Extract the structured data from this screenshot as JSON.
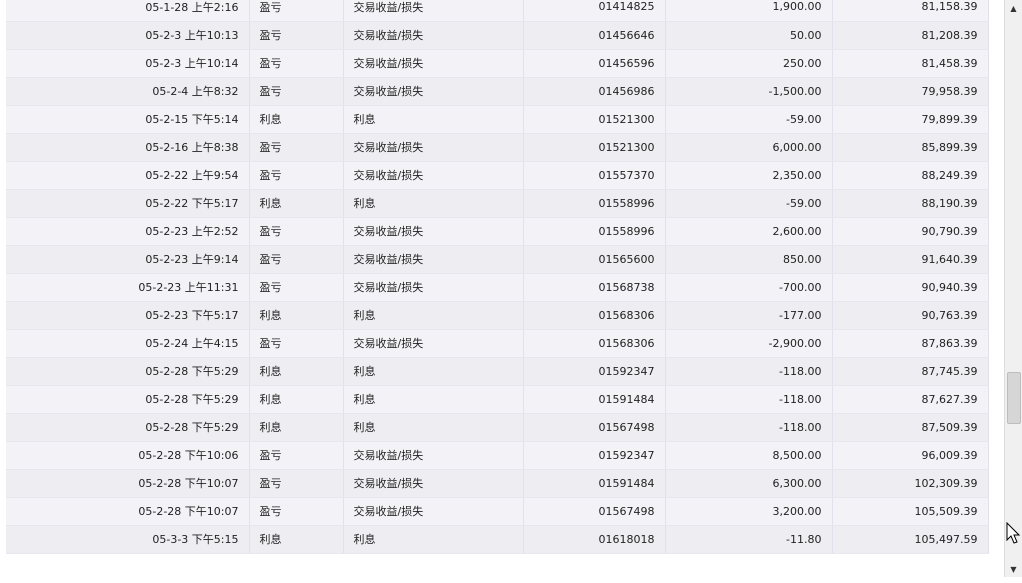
{
  "ledger": {
    "rows": [
      {
        "date": "05-1-28 上午2:16",
        "type": "盈亏",
        "desc": "交易收益/损失",
        "ticket": "01414825",
        "amount": "1,900.00",
        "balance": "81,158.39"
      },
      {
        "date": "05-2-3 上午10:13",
        "type": "盈亏",
        "desc": "交易收益/损失",
        "ticket": "01456646",
        "amount": "50.00",
        "balance": "81,208.39"
      },
      {
        "date": "05-2-3 上午10:14",
        "type": "盈亏",
        "desc": "交易收益/损失",
        "ticket": "01456596",
        "amount": "250.00",
        "balance": "81,458.39"
      },
      {
        "date": "05-2-4 上午8:32",
        "type": "盈亏",
        "desc": "交易收益/损失",
        "ticket": "01456986",
        "amount": "-1,500.00",
        "balance": "79,958.39"
      },
      {
        "date": "05-2-15 下午5:14",
        "type": "利息",
        "desc": "利息",
        "ticket": "01521300",
        "amount": "-59.00",
        "balance": "79,899.39"
      },
      {
        "date": "05-2-16 上午8:38",
        "type": "盈亏",
        "desc": "交易收益/损失",
        "ticket": "01521300",
        "amount": "6,000.00",
        "balance": "85,899.39"
      },
      {
        "date": "05-2-22 上午9:54",
        "type": "盈亏",
        "desc": "交易收益/损失",
        "ticket": "01557370",
        "amount": "2,350.00",
        "balance": "88,249.39"
      },
      {
        "date": "05-2-22 下午5:17",
        "type": "利息",
        "desc": "利息",
        "ticket": "01558996",
        "amount": "-59.00",
        "balance": "88,190.39"
      },
      {
        "date": "05-2-23 上午2:52",
        "type": "盈亏",
        "desc": "交易收益/损失",
        "ticket": "01558996",
        "amount": "2,600.00",
        "balance": "90,790.39"
      },
      {
        "date": "05-2-23 上午9:14",
        "type": "盈亏",
        "desc": "交易收益/损失",
        "ticket": "01565600",
        "amount": "850.00",
        "balance": "91,640.39"
      },
      {
        "date": "05-2-23 上午11:31",
        "type": "盈亏",
        "desc": "交易收益/损失",
        "ticket": "01568738",
        "amount": "-700.00",
        "balance": "90,940.39"
      },
      {
        "date": "05-2-23 下午5:17",
        "type": "利息",
        "desc": "利息",
        "ticket": "01568306",
        "amount": "-177.00",
        "balance": "90,763.39"
      },
      {
        "date": "05-2-24 上午4:15",
        "type": "盈亏",
        "desc": "交易收益/损失",
        "ticket": "01568306",
        "amount": "-2,900.00",
        "balance": "87,863.39"
      },
      {
        "date": "05-2-28 下午5:29",
        "type": "利息",
        "desc": "利息",
        "ticket": "01592347",
        "amount": "-118.00",
        "balance": "87,745.39"
      },
      {
        "date": "05-2-28 下午5:29",
        "type": "利息",
        "desc": "利息",
        "ticket": "01591484",
        "amount": "-118.00",
        "balance": "87,627.39"
      },
      {
        "date": "05-2-28 下午5:29",
        "type": "利息",
        "desc": "利息",
        "ticket": "01567498",
        "amount": "-118.00",
        "balance": "87,509.39"
      },
      {
        "date": "05-2-28 下午10:06",
        "type": "盈亏",
        "desc": "交易收益/损失",
        "ticket": "01592347",
        "amount": "8,500.00",
        "balance": "96,009.39"
      },
      {
        "date": "05-2-28 下午10:07",
        "type": "盈亏",
        "desc": "交易收益/损失",
        "ticket": "01591484",
        "amount": "6,300.00",
        "balance": "102,309.39"
      },
      {
        "date": "05-2-28 下午10:07",
        "type": "盈亏",
        "desc": "交易收益/损失",
        "ticket": "01567498",
        "amount": "3,200.00",
        "balance": "105,509.39"
      },
      {
        "date": "05-3-3 下午5:15",
        "type": "利息",
        "desc": "利息",
        "ticket": "01618018",
        "amount": "-11.80",
        "balance": "105,497.59"
      }
    ]
  },
  "scrollbar": {
    "up_icon": "arrow-up-icon",
    "down_icon": "arrow-down-icon",
    "position_fraction": 0.72
  },
  "cursor": {
    "icon": "mouse-pointer-icon"
  }
}
